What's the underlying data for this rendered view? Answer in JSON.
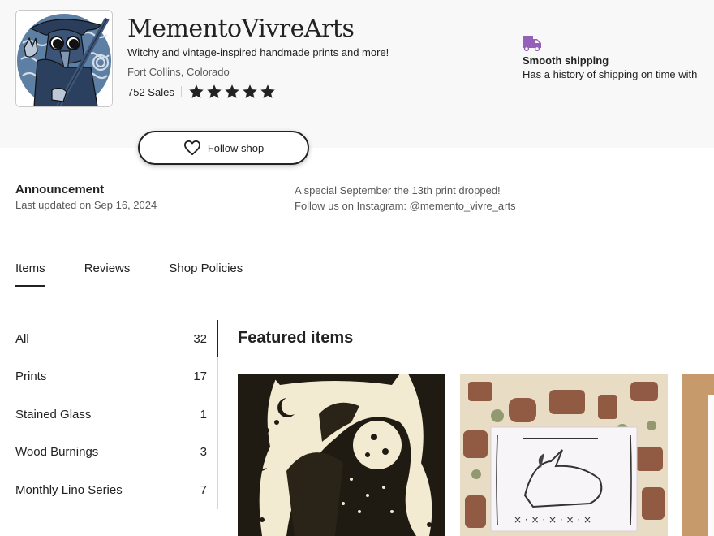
{
  "shop": {
    "name": "MementoVivreArts",
    "tagline": "Witchy and vintage-inspired handmade prints and more!",
    "location": "Fort Collins, Colorado",
    "sales": "752 Sales",
    "rating_stars": 5,
    "avatar_icon": "plague-doctor-avatar"
  },
  "badge": {
    "icon": "truck-icon",
    "title": "Smooth shipping",
    "description": "Has a history of shipping on time with",
    "color": "#9560b8"
  },
  "follow": {
    "label": "Follow shop",
    "icon": "heart-outline-icon"
  },
  "announcement": {
    "title": "Announcement",
    "updated": "Last updated on Sep 16, 2024",
    "lines": [
      "A special September the 13th print dropped!",
      "Follow us on Instagram: @memento_vivre_arts"
    ]
  },
  "tabs": [
    {
      "label": "Items",
      "active": true
    },
    {
      "label": "Reviews",
      "active": false
    },
    {
      "label": "Shop Policies",
      "active": false
    }
  ],
  "sections": [
    {
      "label": "All",
      "count": "32",
      "active": true
    },
    {
      "label": "Prints",
      "count": "17"
    },
    {
      "label": "Stained Glass",
      "count": "1"
    },
    {
      "label": "Wood Burnings",
      "count": "3"
    },
    {
      "label": "Monthly Lino Series",
      "count": "7"
    }
  ],
  "featured": {
    "title": "Featured items",
    "items": [
      {
        "image": "dragon-linocut-print"
      },
      {
        "image": "unicorn-linocut-print"
      },
      {
        "image": "print-on-corkboard"
      }
    ]
  }
}
